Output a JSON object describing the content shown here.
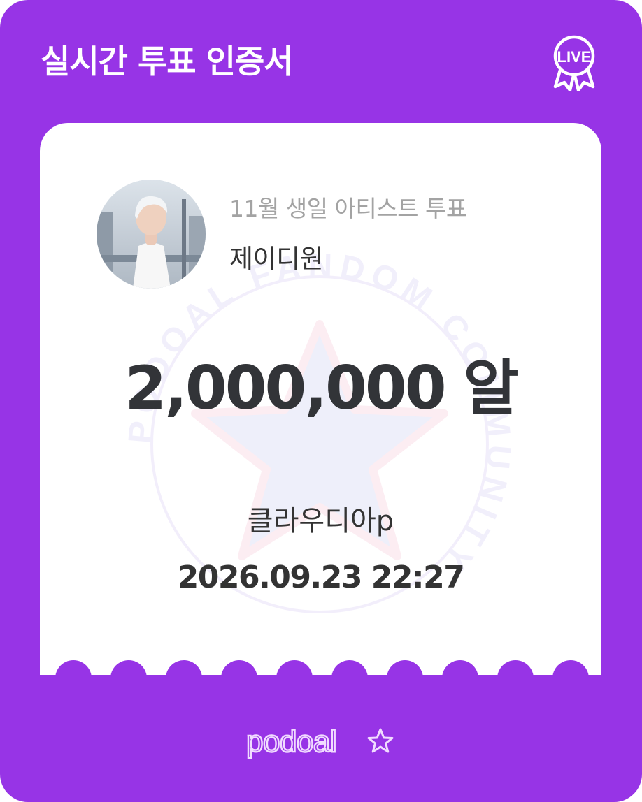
{
  "header": {
    "title": "실시간 투표 인증서",
    "badge_text": "LIVE",
    "badge_icon": "live-ribbon-badge-icon"
  },
  "certificate": {
    "vote_title": "11월 생일 아티스트 투표",
    "artist_name": "제이디원",
    "amount": "2,000,000 알",
    "voter_name": "클라우디아p",
    "datetime": "2026.09.23 22:27",
    "watermark_text": "PODOAL FANDOM COMMUNITY"
  },
  "footer": {
    "brand": "podoal",
    "brand_icon": "star-icon"
  },
  "colors": {
    "frame_purple": "#9734e6",
    "card_white": "#ffffff",
    "primary_text": "#333333",
    "muted_text": "#a3a3a3",
    "brand_lavender": "#f1dcff"
  }
}
